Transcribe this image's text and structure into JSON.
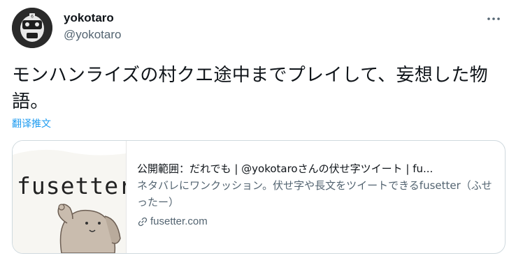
{
  "user": {
    "display_name": "yokotaro",
    "handle": "@yokotaro",
    "avatar_icon": "masked-face-avatar"
  },
  "tweet": {
    "text": "モンハンライズの村クエ途中までプレイして、妄想した物語。",
    "translate_label": "翻译推文"
  },
  "card": {
    "thumbnail_text": "fusetter",
    "title": "公開範囲：だれでも | @yokotaroさんの伏せ字ツイート | fu...",
    "description": "ネタバレにワンクッション。伏せ字や長文をツイートできるfusetter（ふせったー）",
    "domain": "fusetter.com",
    "domain_icon": "link-icon"
  },
  "colors": {
    "link": "#1d9bf0",
    "secondary_text": "#536471",
    "border": "#cfd9de"
  }
}
